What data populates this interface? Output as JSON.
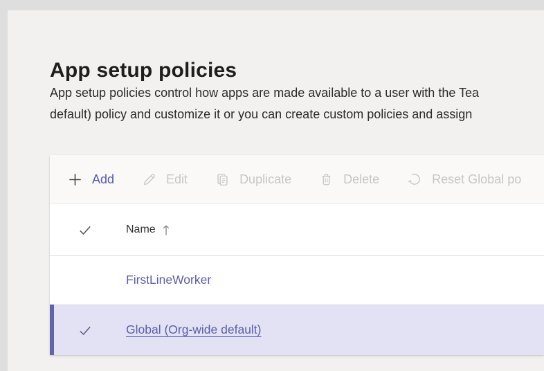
{
  "colors": {
    "accent": "#6264a7",
    "selected_row_bg": "#e2e2f4",
    "selected_row_bar": "#6264a7",
    "link_text": "#5b5da9",
    "add_label": "#5558af",
    "disabled_text": "#c8c6c4",
    "page_bg": "#dedede",
    "card_bg": "#f2f1f0"
  },
  "page": {
    "title": "App setup policies",
    "description_line1": "App setup policies control how apps are made available to a user with the Tea",
    "description_line2": "default) policy and customize it or you can create custom policies and assign"
  },
  "toolbar": {
    "items": [
      {
        "label": "Add",
        "icon": "plus-icon",
        "enabled": true
      },
      {
        "label": "Edit",
        "icon": "pencil-icon",
        "enabled": false
      },
      {
        "label": "Duplicate",
        "icon": "copy-icon",
        "enabled": false
      },
      {
        "label": "Delete",
        "icon": "trash-icon",
        "enabled": false
      },
      {
        "label": "Reset Global po",
        "icon": "reset-icon",
        "enabled": false
      }
    ]
  },
  "table": {
    "header": {
      "name_label": "Name",
      "sort": "ascending"
    },
    "rows": [
      {
        "name": "FirstLineWorker",
        "selected": false
      },
      {
        "name": "Global (Org-wide default)",
        "selected": true
      }
    ]
  }
}
